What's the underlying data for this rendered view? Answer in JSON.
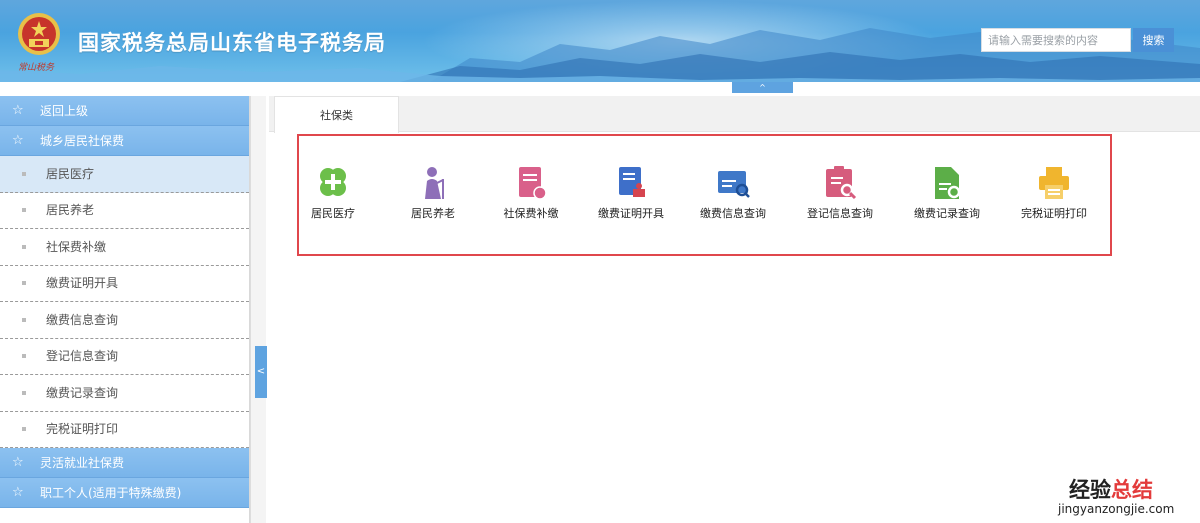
{
  "header": {
    "site_title": "国家税务总局山东省电子税务局",
    "emblem_script": "常山税务",
    "search_placeholder": "请输入需要搜索的内容",
    "search_button": "搜索",
    "collapse_glyph": "^"
  },
  "sidebar": {
    "back": "返回上级",
    "group_1": "城乡居民社保费",
    "items": [
      "居民医疗",
      "居民养老",
      "社保费补缴",
      "缴费证明开具",
      "缴费信息查询",
      "登记信息查询",
      "缴费记录查询",
      "完税证明打印"
    ],
    "group_2": "灵活就业社保费",
    "group_3": "职工个人(适用于特殊缴费)",
    "toggle_glyph": "<"
  },
  "tabs": [
    "社保类"
  ],
  "apps": [
    {
      "label": "居民医疗",
      "icon": "medical-cross-icon",
      "color": "#6cbf4a"
    },
    {
      "label": "居民养老",
      "icon": "elderly-person-icon",
      "color": "#8e6fb8"
    },
    {
      "label": "社保费补缴",
      "icon": "document-payment-icon",
      "color": "#d9608a"
    },
    {
      "label": "缴费证明开具",
      "icon": "certificate-stamp-icon",
      "color": "#3e6fc9"
    },
    {
      "label": "缴费信息查询",
      "icon": "payment-card-search-icon",
      "color": "#3f78c8"
    },
    {
      "label": "登记信息查询",
      "icon": "registration-search-icon",
      "color": "#d65c7d"
    },
    {
      "label": "缴费记录查询",
      "icon": "record-search-icon",
      "color": "#5cae48"
    },
    {
      "label": "完税证明打印",
      "icon": "printer-icon",
      "color": "#f0b52e"
    }
  ],
  "watermark": {
    "title_main": "经验",
    "title_accent": "总结",
    "url": "jingyanzongjie.com"
  }
}
